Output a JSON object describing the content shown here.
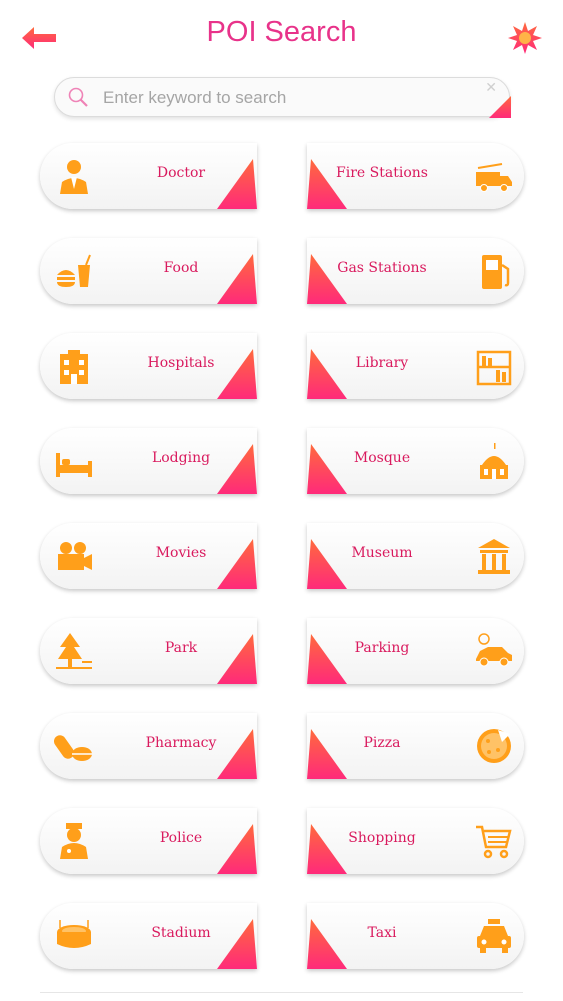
{
  "header": {
    "title": "POI Search",
    "back_icon": "back-arrow-icon",
    "settings_icon": "badge-star-icon"
  },
  "search": {
    "placeholder": "Enter keyword to search",
    "value": "",
    "clear_glyph": "✕"
  },
  "colors": {
    "accent_pink": "#e8338a",
    "label_pink": "#d91a5e",
    "icon_orange": "#ff9f1a",
    "gradient_top": "#ff6a3d",
    "gradient_bottom": "#ff2a7a"
  },
  "categories": [
    {
      "label": "Doctor",
      "icon": "doctor-icon"
    },
    {
      "label": "Fire Stations",
      "icon": "fire-truck-icon"
    },
    {
      "label": "Food",
      "icon": "food-icon"
    },
    {
      "label": "Gas Stations",
      "icon": "gas-pump-icon"
    },
    {
      "label": "Hospitals",
      "icon": "hospital-icon"
    },
    {
      "label": "Library",
      "icon": "library-icon"
    },
    {
      "label": "Lodging",
      "icon": "bed-icon"
    },
    {
      "label": "Mosque",
      "icon": "mosque-icon"
    },
    {
      "label": "Movies",
      "icon": "movie-camera-icon"
    },
    {
      "label": "Museum",
      "icon": "museum-icon"
    },
    {
      "label": "Park",
      "icon": "tree-icon"
    },
    {
      "label": "Parking",
      "icon": "car-parking-icon"
    },
    {
      "label": "Pharmacy",
      "icon": "pill-icon"
    },
    {
      "label": "Pizza",
      "icon": "pizza-icon"
    },
    {
      "label": "Police",
      "icon": "police-icon"
    },
    {
      "label": "Shopping",
      "icon": "shopping-cart-icon"
    },
    {
      "label": "Stadium",
      "icon": "stadium-icon"
    },
    {
      "label": "Taxi",
      "icon": "taxi-icon"
    }
  ]
}
